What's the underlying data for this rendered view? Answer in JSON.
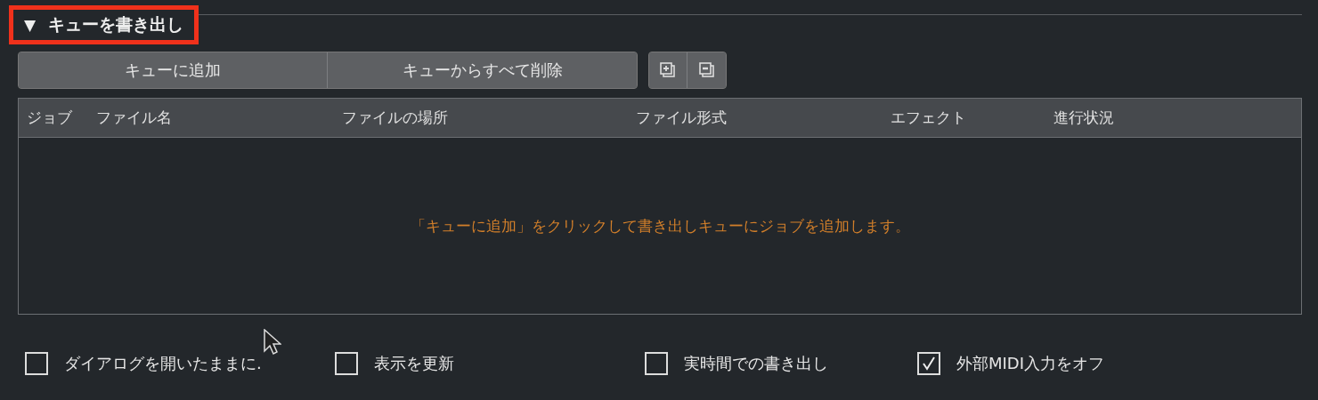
{
  "section": {
    "title": "キューを書き出し",
    "expanded": true,
    "toggle": "▼",
    "highlighted": true
  },
  "buttons": [
    "キューに追加",
    "キューからすべて削除"
  ],
  "table": {
    "columns": [
      "ジョブ",
      "ファイル名",
      "ファイルの場所",
      "ファイル形式",
      "エフェクト",
      "進行状況"
    ],
    "empty_message": "「キューに追加」をクリックして書き出しキューにジョブを追加します。"
  },
  "options": [
    {
      "label": "ダイアログを開いたままに.",
      "checked": false
    },
    {
      "label": "表示を更新",
      "checked": false
    },
    {
      "label": "実時間での書き出し",
      "checked": false
    },
    {
      "label": "外部MIDI入力をオフ",
      "checked": true
    }
  ]
}
